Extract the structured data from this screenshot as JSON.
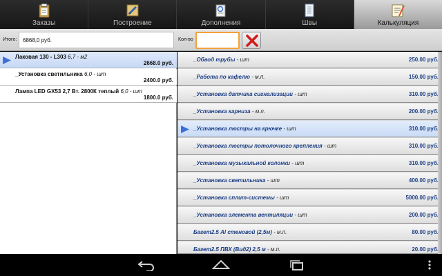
{
  "tabs": [
    {
      "label": "Заказы",
      "icon": "orders-clipboard-icon",
      "active": false
    },
    {
      "label": "Построение",
      "icon": "build-pencil-icon",
      "active": false
    },
    {
      "label": "Дополнения",
      "icon": "additions-doc-icon",
      "active": false
    },
    {
      "label": "Швы",
      "icon": "seams-notepad-icon",
      "active": false
    },
    {
      "label": "Калькуляция",
      "icon": "calculator-notes-icon",
      "active": true
    }
  ],
  "input_row": {
    "total_label": "Итого:",
    "total_value": "6868,0 руб.",
    "qty_label": "Кол-во",
    "qty_value": ""
  },
  "left_items": [
    {
      "name": "Лаковая 130 - L303",
      "unit": "6,7 - м2",
      "price": "2668.0 руб.",
      "selected": true
    },
    {
      "name": "_Установка светильника",
      "unit": "6,0 - шт",
      "price": "2400.0 руб.",
      "selected": false
    },
    {
      "name": "Лампа LED GX53 2,7 Вт. 2800К теплый",
      "unit": "6,0 - шт",
      "price": "1800.0 руб.",
      "selected": false
    }
  ],
  "right_items": [
    {
      "name": "_Обвод трубы",
      "unit": "- шт",
      "price": "250.00 руб.",
      "selected": false
    },
    {
      "name": "_Работа по кафелю",
      "unit": "- м.п.",
      "price": "150.00 руб.",
      "selected": false
    },
    {
      "name": "_Установка датчика сигнализации",
      "unit": "- шт",
      "price": "310.00 руб.",
      "selected": false
    },
    {
      "name": "_Установка карниза",
      "unit": "- м.п.",
      "price": "200.00 руб.",
      "selected": false
    },
    {
      "name": "_Установка люстры на крючке",
      "unit": "- шт",
      "price": "310.00 руб.",
      "selected": true
    },
    {
      "name": "_Установка люстры потолочного крепления",
      "unit": "- шт",
      "price": "310.00 руб.",
      "selected": false
    },
    {
      "name": "_Установка музыкальной колонки",
      "unit": "- шт",
      "price": "310.00 руб.",
      "selected": false
    },
    {
      "name": "_Установка светильника",
      "unit": "- шт",
      "price": "400.00 руб.",
      "selected": false
    },
    {
      "name": "_Установка сплит-системы",
      "unit": "- шт",
      "price": "5000.00 руб.",
      "selected": false
    },
    {
      "name": "_Установка элемента вентиляции",
      "unit": "- шт",
      "price": "200.00 руб.",
      "selected": false
    },
    {
      "name": "Багет2.5 Al стеновой (2,5м)",
      "unit": "- м.п.",
      "price": "80.00 руб.",
      "selected": false
    },
    {
      "name": "Багет2.5 ПВХ (Вид2) 2,5 м",
      "unit": "- м.п.",
      "price": "20.00 руб.",
      "selected": false
    }
  ],
  "nav_icons": [
    "back-icon",
    "home-icon",
    "recent-apps-icon",
    "overflow-menu-icon"
  ],
  "colors": {
    "accent_orange": "#f2a13a",
    "price_blue": "#1c3f86",
    "delete_red": "#d11a1a"
  }
}
